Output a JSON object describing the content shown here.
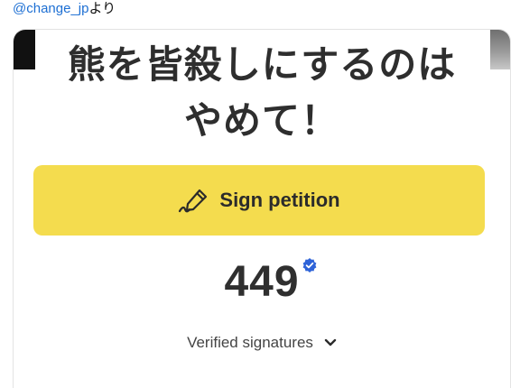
{
  "source": {
    "handle": "@change_jp",
    "suffix": "より"
  },
  "card": {
    "headline_line1": "熊を皆殺しにするのは",
    "headline_line2": "やめて！",
    "sign_button_label": "Sign petition",
    "signature_count": "449",
    "verified_label": "Verified signatures"
  },
  "icons": {
    "sign": "signature-pen-icon",
    "verified": "verified-check-icon",
    "toggle": "chevron-down-icon"
  },
  "colors": {
    "button": "#f4dc4e",
    "badge": "#2e63d8",
    "handle": "#1d6fd3"
  }
}
